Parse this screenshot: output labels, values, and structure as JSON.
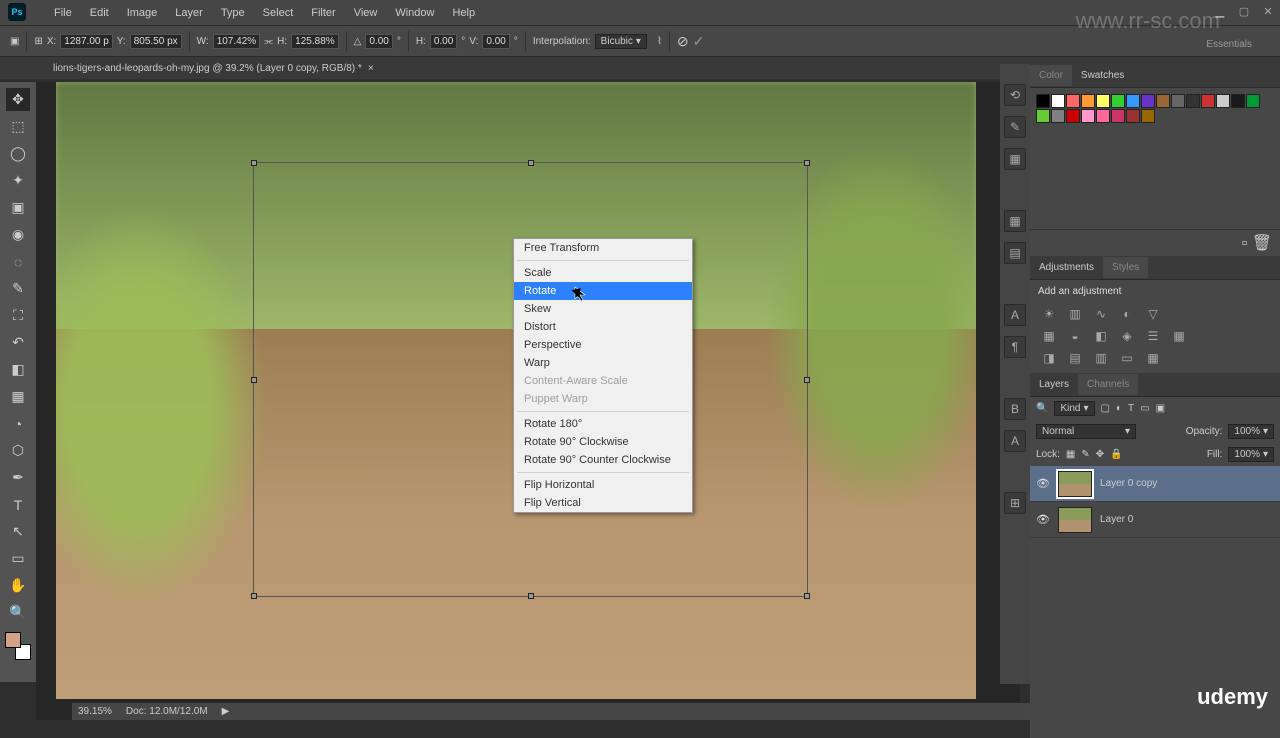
{
  "menubar": {
    "file": "File",
    "edit": "Edit",
    "image": "Image",
    "layer": "Layer",
    "type": "Type",
    "select": "Select",
    "filter": "Filter",
    "view": "View",
    "window": "Window",
    "help": "Help"
  },
  "ps": "Ps",
  "options": {
    "x_label": "X:",
    "x_val": "1287.00 p",
    "y_label": "Y:",
    "y_val": "805.50 px",
    "w_label": "W:",
    "w_val": "107.42%",
    "h_label": "H:",
    "h_val": "125.88%",
    "a_label": "",
    "a_val": "0.00",
    "h2_label": "H:",
    "h2_val": "0.00",
    "v_label": "V:",
    "v_val": "0.00",
    "interp_label": "Interpolation:",
    "interp_val": "Bicubic"
  },
  "workspace": "Essentials",
  "tab": {
    "name": "lions-tigers-and-leopards-oh-my.jpg @ 39.2% (Layer 0 copy, RGB/8) *",
    "close": "×"
  },
  "status": {
    "zoom": "39.15%",
    "doc": "Doc: 12.0M/12.0M",
    "arrow": "▶"
  },
  "context": {
    "free_transform": "Free Transform",
    "scale": "Scale",
    "rotate": "Rotate",
    "skew": "Skew",
    "distort": "Distort",
    "perspective": "Perspective",
    "warp": "Warp",
    "content_aware": "Content-Aware Scale",
    "puppet": "Puppet Warp",
    "rot180": "Rotate 180°",
    "rot90cw": "Rotate 90° Clockwise",
    "rot90ccw": "Rotate 90° Counter Clockwise",
    "fliph": "Flip Horizontal",
    "flipv": "Flip Vertical"
  },
  "panels": {
    "color": "Color",
    "swatches": "Swatches",
    "adjustments": "Adjustments",
    "styles": "Styles",
    "adj_hint": "Add an adjustment",
    "layers": "Layers",
    "channels": "Channels",
    "kind": "Kind",
    "normal": "Normal",
    "opacity_lbl": "Opacity:",
    "opacity_val": "100%",
    "lock_lbl": "Lock:",
    "fill_lbl": "Fill:",
    "fill_val": "100%",
    "layer0copy": "Layer 0 copy",
    "layer0": "Layer 0"
  },
  "icons": {
    "min": "▁",
    "max": "▢",
    "close": "✕",
    "move": "✥",
    "marquee": "⬚",
    "lasso": "◯",
    "wand": "✦",
    "crop": "▣",
    "eyedrop": "◉",
    "heal": "◌",
    "brush": "✎",
    "stamp": "⛶",
    "history": "↶",
    "eraser": "◧",
    "gradient": "▦",
    "blur": "◔",
    "dodge": "⬡",
    "pen": "✒",
    "text": "T",
    "path": "↖",
    "shape": "▭",
    "hand": "✋",
    "zoom": "🔍",
    "eye": "👁",
    "chev": "▾"
  },
  "swc": [
    "#000000",
    "#ffffff",
    "#ff6666",
    "#ff9933",
    "#ffff66",
    "#33cc33",
    "#3399ff",
    "#6633cc",
    "#996633",
    "#666666",
    "#333333",
    "#cc3333",
    "#cccccc",
    "#1a1a1a",
    "#009933",
    "#66cc33",
    "#808080",
    "#cc0000",
    "#ff99cc",
    "#ff6699",
    "#cc3366",
    "#993333",
    "#996600"
  ],
  "udemy": "udemy",
  "rrsc": "www.rr-sc.com"
}
